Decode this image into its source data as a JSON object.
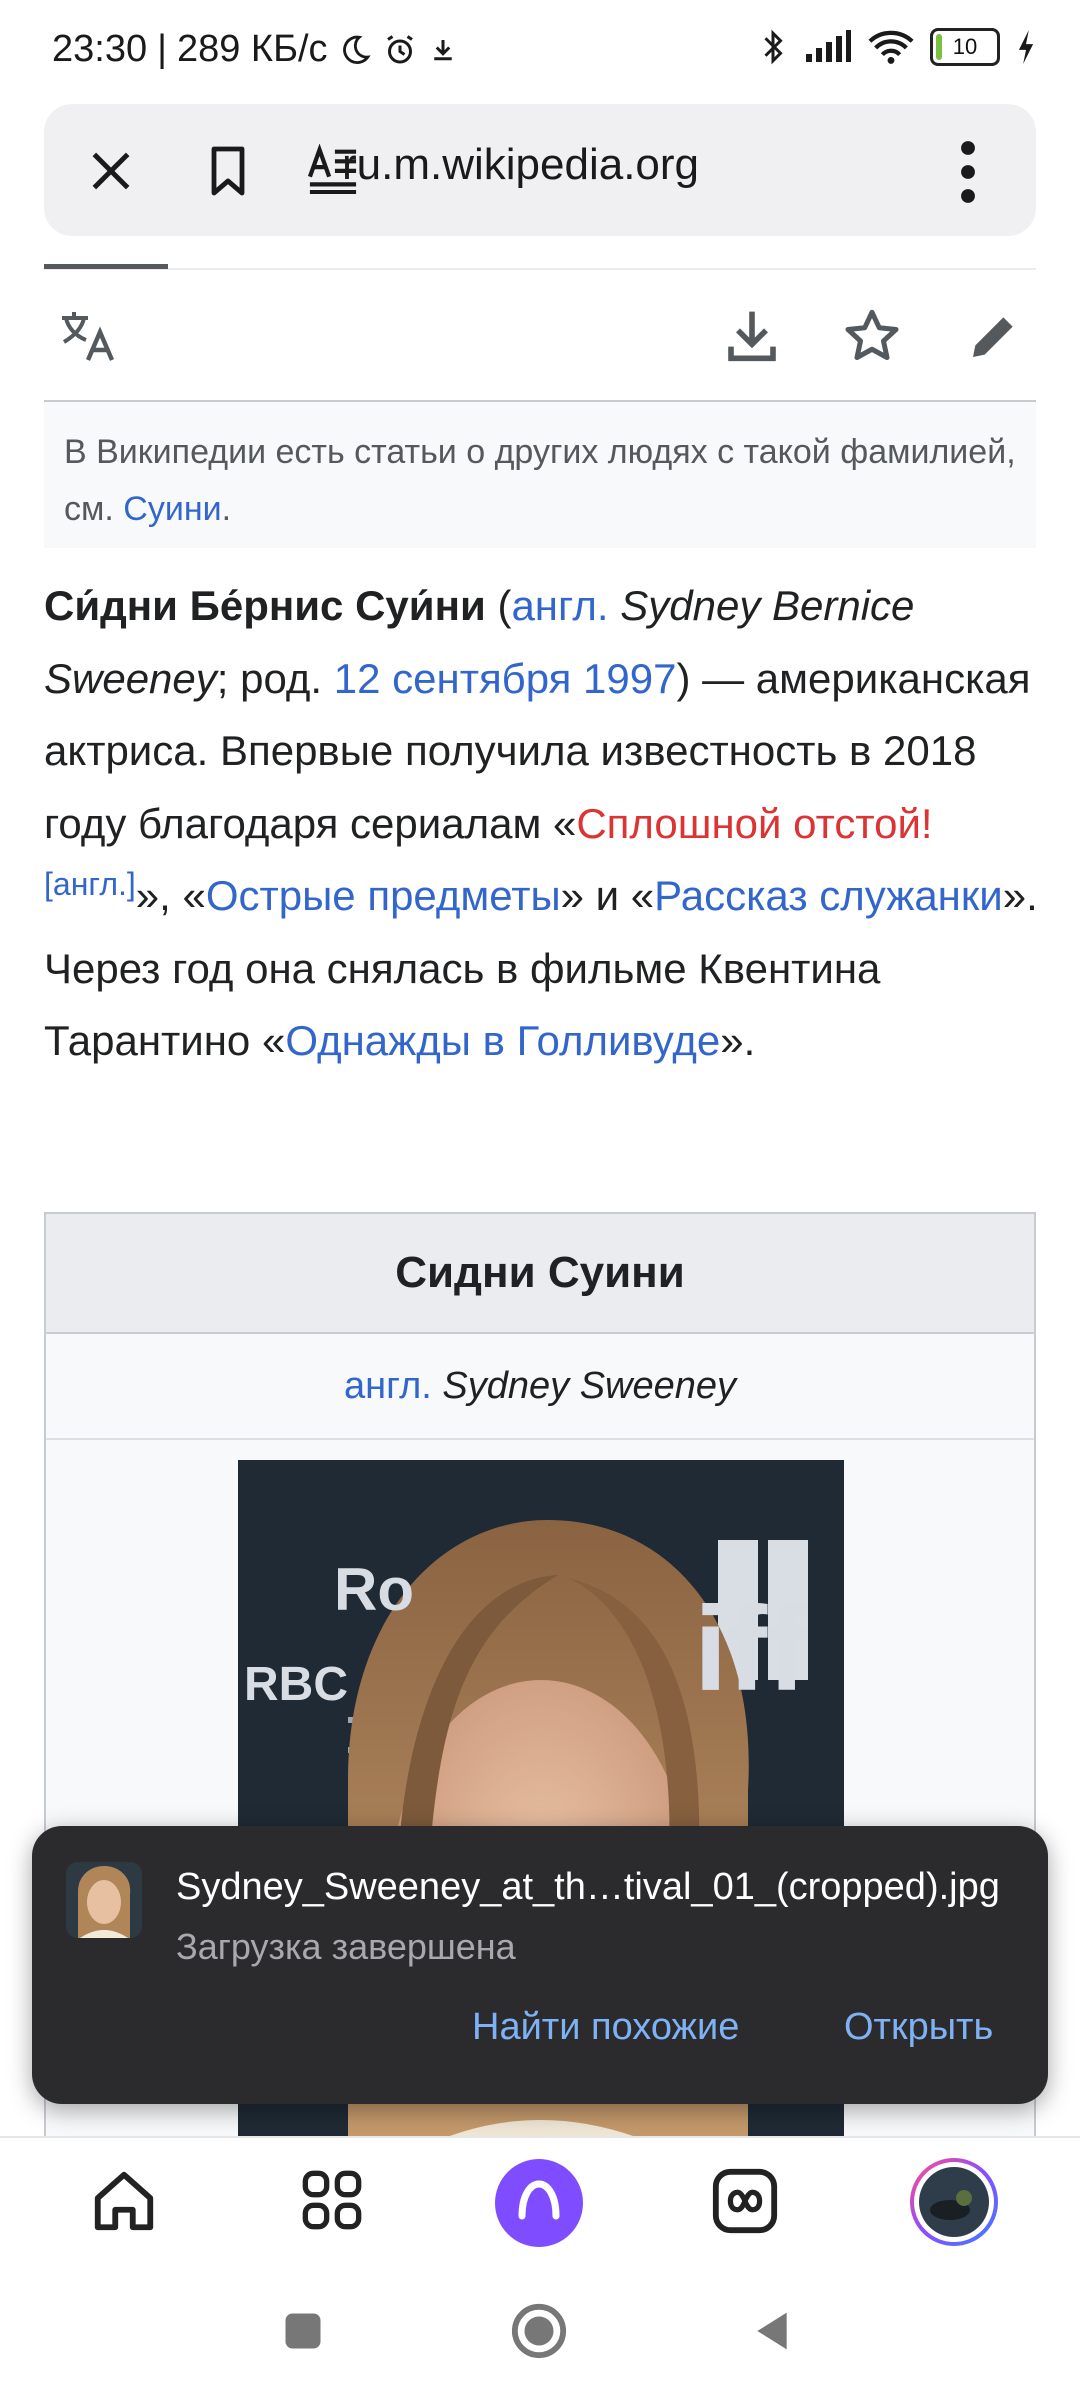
{
  "status_bar": {
    "time": "23:30",
    "speed": "289 КБ/с",
    "battery": "10",
    "colors": {
      "battery_fill": "#7ac142"
    }
  },
  "browser": {
    "url": "ru.m.wikipedia.org",
    "icons": [
      "close-icon",
      "bookmark-icon",
      "reader-mode-icon",
      "more-icon"
    ]
  },
  "wiki_toolbar": {
    "icons": [
      "translate-icon",
      "download-icon",
      "star-icon",
      "edit-icon"
    ]
  },
  "hatnote": {
    "text": "В Википедии есть статьи о других людях с такой фамилией, см. ",
    "link": "Суини",
    "end": "."
  },
  "lead": {
    "bold_name": "Си́дни Бе́рнис Суи́ни",
    "p1": " (",
    "lang_link": "англ.",
    "orig_name": " Sydney Bernice Sweeney",
    "p2": "; род. ",
    "date_link": "12 сентября 1997",
    "p3": ") — американская актриса. Впервые получила известность в 2018 году благодаря сериалам «",
    "red_link": "Сплошной отстой!",
    "sup_link": "[англ.]",
    "p4": "», «",
    "link_sharp": "Острые предметы",
    "p5": "» и «",
    "link_handmaid": "Рассказ служанки",
    "p6": "». Через год она снялась в фильме Квентина Тарантино «",
    "link_hollywood": "Однажды в Голливуде",
    "p7": "»."
  },
  "infobox": {
    "title": "Сидни Суини",
    "lang_link": "англ.",
    "orig_name": "Sydney Sweeney",
    "photo_text": "RBC",
    "photo_text_tiff": "iff",
    "photo_text_ro": "Ro"
  },
  "toast": {
    "filename": "Sydney_Sweeney_at_th…tival_01_(cropped).jpg",
    "status": "Загрузка завершена",
    "find_similar": "Найти похожие",
    "open": "Открыть"
  },
  "bottom_nav": {
    "icons": [
      "home-icon",
      "apps-icon",
      "alice-icon",
      "tabs-icon",
      "profile-avatar"
    ],
    "colors": {
      "alice": "#7f4dff"
    }
  },
  "system_nav": {
    "icons": [
      "recents-icon",
      "home-circle-icon",
      "back-icon"
    ]
  }
}
